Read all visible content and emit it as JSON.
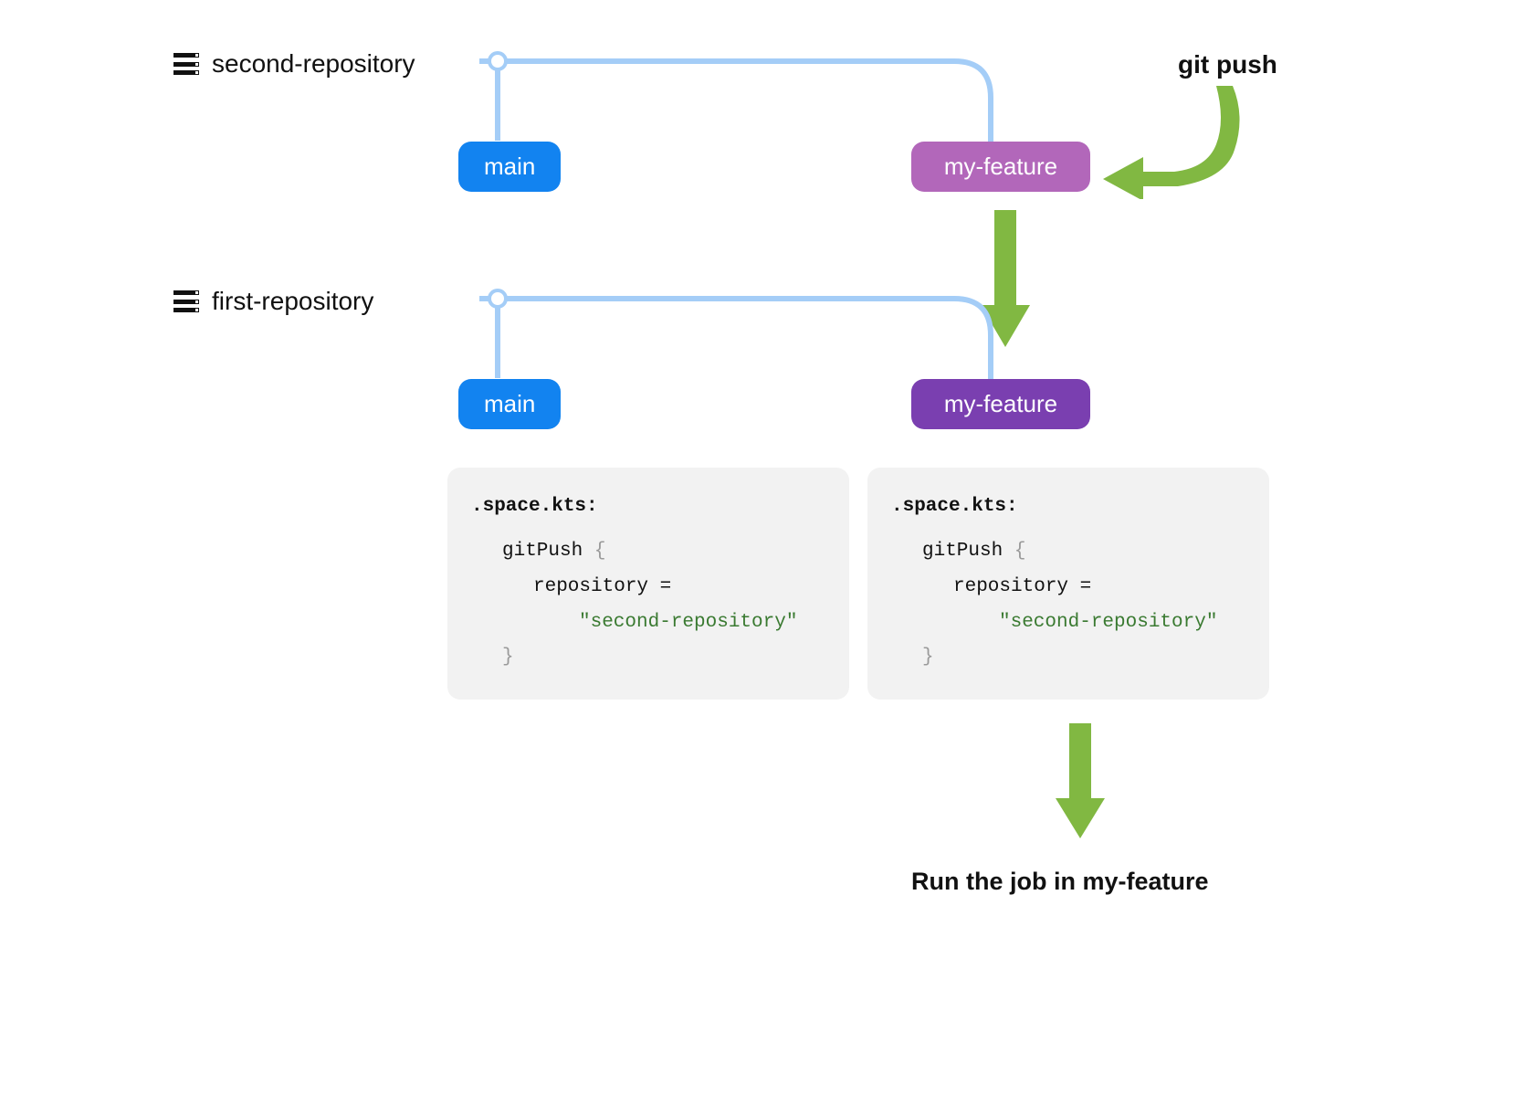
{
  "repo1": {
    "name": "second-repository"
  },
  "repo2": {
    "name": "first-repository"
  },
  "branches": {
    "main": "main",
    "feature_top": "my-feature",
    "feature_bottom": "my-feature"
  },
  "labels": {
    "git_push": "git push",
    "run_job": "Run the job in my-feature"
  },
  "code": {
    "title": ".space.kts:",
    "line1": "gitPush",
    "line2": "repository =",
    "line3": "\"second-repository\""
  },
  "colors": {
    "branch_line": "#a4cdf7",
    "blue": "#1283f0",
    "lavender": "#b267ba",
    "purple": "#7a3fb0",
    "green": "#81b842",
    "code_bg": "#f2f2f2",
    "string": "#3a7a31",
    "brace": "#9a9a9a"
  }
}
